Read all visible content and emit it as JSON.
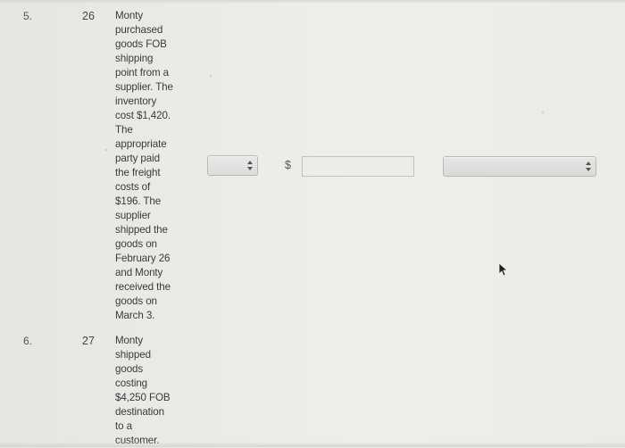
{
  "rows": [
    {
      "number": "5.",
      "date": "26",
      "description_lines": [
        "Monty",
        "purchased",
        "goods FOB",
        "shipping",
        "point from a",
        "supplier. The",
        "inventory",
        "cost $1,420.",
        "The",
        "appropriate",
        "party paid",
        "the freight",
        "costs of",
        "$196. The",
        "supplier",
        "shipped the",
        "goods on",
        "February 26",
        "and Monty",
        "received the",
        "goods on",
        "March 3."
      ],
      "controls": {
        "debit_credit_select": {
          "selected": "",
          "icon": "up-down-arrows-icon"
        },
        "currency_symbol": "$",
        "amount_input": {
          "value": "",
          "placeholder": ""
        },
        "account_select": {
          "selected": "",
          "icon": "up-down-arrows-icon"
        }
      }
    },
    {
      "number": "6.",
      "date": "27",
      "description_lines": [
        "Monty",
        "shipped",
        "goods",
        "costing",
        "$4,250 FOB",
        "destination",
        "to a",
        "customer."
      ]
    }
  ],
  "pointer": {
    "icon": "mouse-cursor-arrow-icon"
  }
}
